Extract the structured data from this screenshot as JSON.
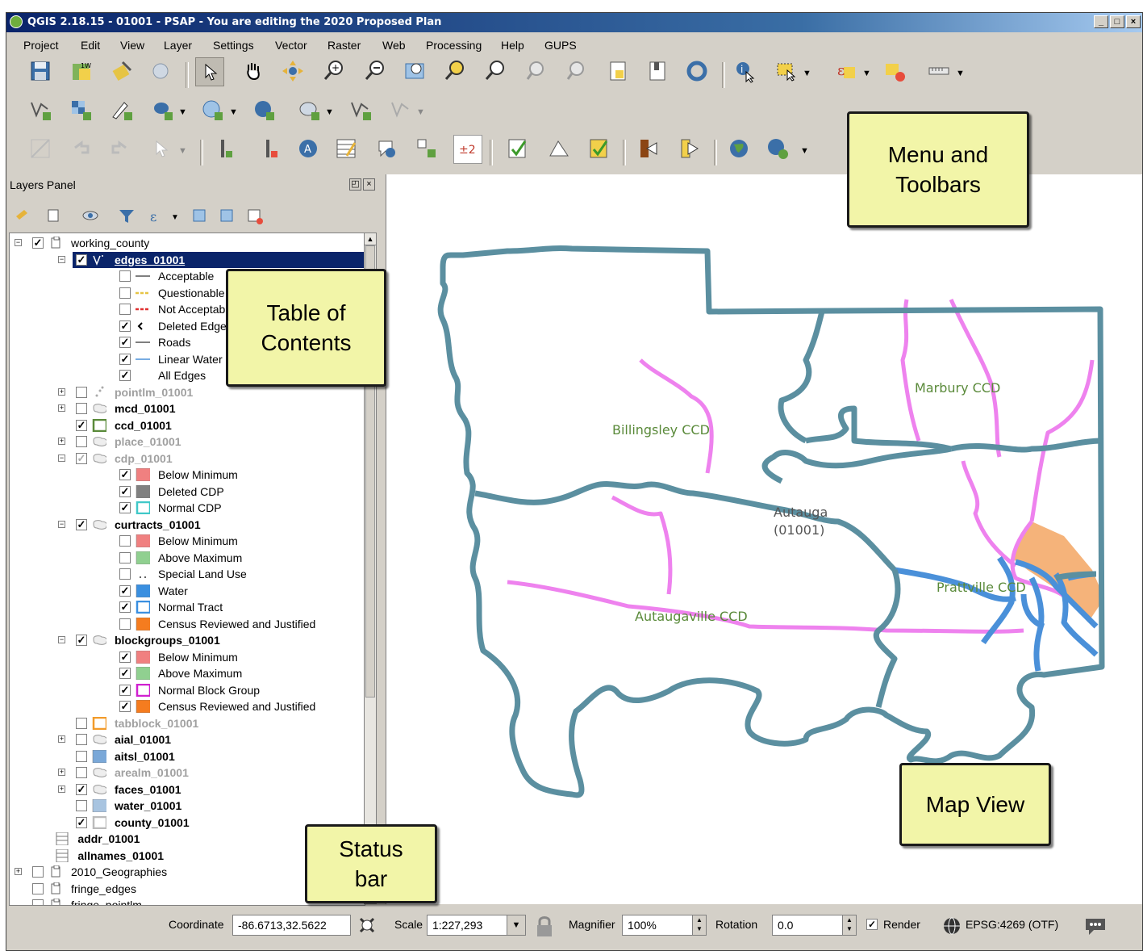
{
  "window": {
    "title": "QGIS 2.18.15 - 01001 - PSAP - You are editing the 2020 Proposed Plan"
  },
  "menu": [
    "Project",
    "Edit",
    "View",
    "Layer",
    "Settings",
    "Vector",
    "Raster",
    "Web",
    "Processing",
    "Help",
    "GUPS"
  ],
  "layers_panel": {
    "title": "Layers Panel",
    "rows": [
      {
        "label": "working_county",
        "checked": true
      },
      {
        "label": "edges_01001",
        "checked": true
      },
      {
        "label": "Acceptable",
        "checked": false
      },
      {
        "label": "Questionable",
        "checked": false
      },
      {
        "label": "Not Acceptable",
        "checked": false
      },
      {
        "label": "Deleted Edge",
        "checked": true
      },
      {
        "label": "Roads",
        "checked": true
      },
      {
        "label": "Linear Water",
        "checked": true
      },
      {
        "label": "All Edges",
        "checked": true
      },
      {
        "label": "pointlm_01001",
        "checked": false
      },
      {
        "label": "mcd_01001",
        "checked": false
      },
      {
        "label": "ccd_01001",
        "checked": true
      },
      {
        "label": "place_01001",
        "checked": false
      },
      {
        "label": "cdp_01001",
        "checked": true
      },
      {
        "label": "Below Minimum",
        "checked": true
      },
      {
        "label": "Deleted CDP",
        "checked": true
      },
      {
        "label": "Normal CDP",
        "checked": true
      },
      {
        "label": "curtracts_01001",
        "checked": true
      },
      {
        "label": "Below Minimum",
        "checked": false
      },
      {
        "label": "Above Maximum",
        "checked": false
      },
      {
        "label": "Special Land Use",
        "checked": false
      },
      {
        "label": "Water",
        "checked": true
      },
      {
        "label": "Normal Tract",
        "checked": true
      },
      {
        "label": "Census Reviewed and Justified",
        "checked": false
      },
      {
        "label": "blockgroups_01001",
        "checked": true
      },
      {
        "label": "Below Minimum",
        "checked": true
      },
      {
        "label": "Above Maximum",
        "checked": true
      },
      {
        "label": "Normal Block Group",
        "checked": true
      },
      {
        "label": "Census Reviewed and Justified",
        "checked": true
      },
      {
        "label": "tabblock_01001",
        "checked": false
      },
      {
        "label": "aial_01001",
        "checked": false
      },
      {
        "label": "aitsl_01001",
        "checked": false
      },
      {
        "label": "arealm_01001",
        "checked": false
      },
      {
        "label": "faces_01001",
        "checked": true
      },
      {
        "label": "water_01001",
        "checked": false
      },
      {
        "label": "county_01001",
        "checked": true
      },
      {
        "label": "addr_01001",
        "checked": false
      },
      {
        "label": "allnames_01001",
        "checked": false
      },
      {
        "label": "2010_Geographies",
        "checked": false
      },
      {
        "label": "fringe_edges",
        "checked": false
      },
      {
        "label": "fringe_pointlm",
        "checked": false
      }
    ]
  },
  "map": {
    "labels": {
      "billingsley": "Billingsley CCD",
      "marbury": "Marbury CCD",
      "autauga": "Autauga",
      "autauga_code": "(01001)",
      "prattville": "Prattville CCD",
      "autaugaville": "Autaugaville CCD"
    },
    "colors": {
      "county_outline": "#5b8fa0",
      "ccd_lines": "#ee82ee",
      "water": "#4a90d9",
      "justified": "#f5b37a"
    }
  },
  "statusbar": {
    "coordinate_label": "Coordinate",
    "coordinate_value": "-86.6713,32.5622",
    "scale_label": "Scale",
    "scale_value": "1:227,293",
    "magnifier_label": "Magnifier",
    "magnifier_value": "100%",
    "rotation_label": "Rotation",
    "rotation_value": "0.0",
    "render_label": "Render",
    "render_checked": true,
    "crs": "EPSG:4269 (OTF)"
  },
  "callouts": {
    "menu_toolbars": [
      "Menu and",
      "Toolbars"
    ],
    "toc": [
      "Table of",
      "Contents"
    ],
    "map_view": [
      "Map View"
    ],
    "status_bar": [
      "Status",
      "bar"
    ]
  }
}
